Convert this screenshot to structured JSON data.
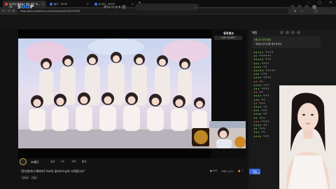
{
  "browser": {
    "tabs": [
      {
        "label": "[LIVE] 패배로? 세상 모든 주...",
        "color": "#e03a2f",
        "active": true
      },
      {
        "label": "홈가 - SOOP",
        "color": "#2b6fd6",
        "active": false
      },
      {
        "label": "[LIVE] - SOOP",
        "color": "#2b6fd6",
        "active": false
      }
    ],
    "url": "https://play.sooplive.co.kr/movie/ssk/2126/375993",
    "new_tab": "+"
  },
  "site": {
    "logo_main": "S",
    "logo_o": "OO",
    "logo_end": "P",
    "channel_label": "웹프로 보기장 ▼",
    "search_icon": "⌕"
  },
  "player": {
    "overlay_title": "뮤직뱅크",
    "overlay_sub": "LIVE 다시보기",
    "video_alt": "group photo on stage"
  },
  "info": {
    "streamer": "조혜진",
    "stream_title": "[정산원하니-해바라] 어코의 날코로스님의 시작합니다!",
    "tags": [
      "보이는",
      "정보"
    ],
    "buttons": [
      "공유",
      "UP",
      "구독",
      "즐겨"
    ],
    "stats": [
      "● 493",
      "조회 1,012",
      "🔥 7"
    ]
  },
  "chat": {
    "header": "채팅",
    "notice_title": "[매니저 공지사항]",
    "notice_body": "· 채팅창 공지사항 확인하세요",
    "lines": [
      {
        "name": "ㅎㅎㅎㅎㅎ",
        "text": "ㅋㅋㅋㅋ",
        "red": false
      },
      {
        "name": "ㅎㅎ",
        "text": "ㅋㅋㅋㅋㅋㅋ",
        "red": false
      },
      {
        "name": "ㅎㅎㅎㅎㅎ",
        "text": "ㅋㅋㅋ",
        "red": false
      },
      {
        "name": "ㅎㅎㅎ",
        "text": "ㅋㅋㅋㅋ",
        "red": false
      },
      {
        "name": "ㅎㅎㅎㅎ",
        "text": "ㅋㅋ",
        "red": false
      },
      {
        "name": "ㅎㅎㅎㅎㅎ",
        "text": "ㅋㅋㅋㅋㅋ",
        "red": false
      },
      {
        "name": "ㅎㅎㅎ",
        "text": "ㅋㅋㅋ",
        "red": false
      },
      {
        "name": "ㅎㅎㅎㅎ",
        "text": "ㅋㅋㅋㅋ",
        "red": false
      },
      {
        "name": "ㅎㅎ",
        "text": "ㅋㅋ",
        "red": true
      },
      {
        "name": "ㅎㅎㅎㅎ",
        "text": "ㅋㅋㅋ",
        "red": false
      },
      {
        "name": "ㅎㅎㅎ",
        "text": "ㅋㅋㅋㅋ",
        "red": false
      },
      {
        "name": "ㅎㅎ",
        "text": "ㅋㅋ",
        "red": true
      },
      {
        "name": "ㅎㅎㅎㅎ",
        "text": "ㅋㅋㅋ",
        "red": false
      },
      {
        "name": "ㅎㅎㅎ",
        "text": "ㅋㅋ",
        "red": false
      },
      {
        "name": "ㅎㅎ",
        "text": "ㅋㅋㅋ",
        "red": true
      },
      {
        "name": "ㅎㅎㅎㅎ",
        "text": "ㅋㅋ",
        "red": false
      },
      {
        "name": "ㅎㅎㅎ",
        "text": "ㅋㅋㅋ",
        "red": false
      },
      {
        "name": "ㅎㅎㅎㅎ",
        "text": "ㅋㅋ",
        "red": false
      },
      {
        "name": "ㅎㅎ",
        "text": "ㅋㅋㅋ",
        "red": false
      },
      {
        "name": "ㅎㅎㅎ",
        "text": "ㅋㅋㅋㅋ",
        "red": true
      },
      {
        "name": "ㅎㅎㅎㅎ",
        "text": "ㅋㅋ",
        "red": false
      },
      {
        "name": "ㅎㅎ",
        "text": "ㅋㅋㅋ",
        "red": false
      },
      {
        "name": "ㅎㅎㅎ",
        "text": "ㅋㅋ",
        "red": false
      },
      {
        "name": "ㅎㅎㅎㅎ",
        "text": "ㅋㅋㅋ",
        "red": false
      }
    ],
    "vip_label": "리스트",
    "send_label": "전송"
  },
  "colors": {
    "accent": "#3a8bff",
    "chat_name": "#8fd064",
    "chat_name_alt": "#e67070"
  }
}
